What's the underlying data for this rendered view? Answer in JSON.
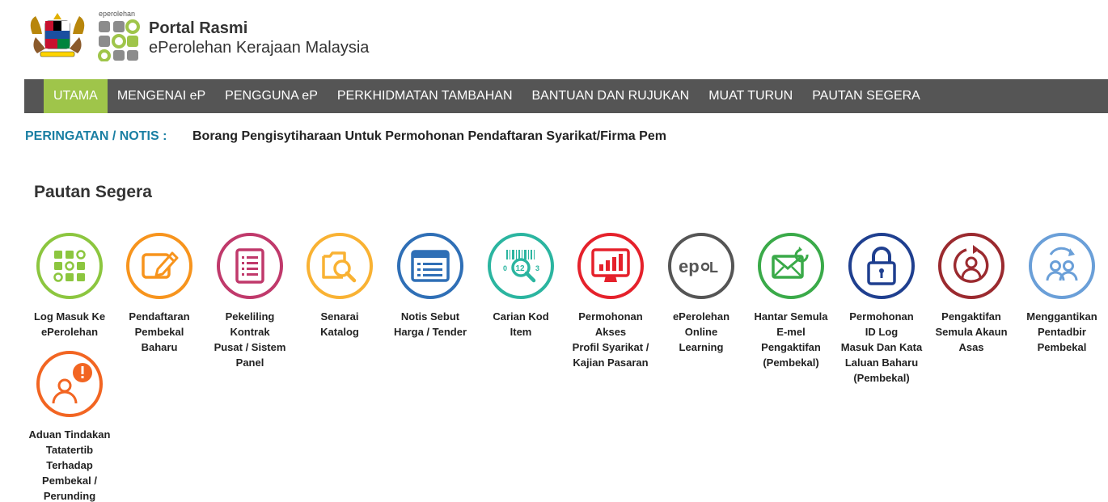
{
  "header": {
    "logo_small_text": "eperolehan",
    "title": "Portal Rasmi",
    "subtitle": "ePerolehan Kerajaan Malaysia"
  },
  "nav": {
    "items": [
      {
        "label": "UTAMA"
      },
      {
        "label": "MENGENAI eP"
      },
      {
        "label": "PENGGUNA eP"
      },
      {
        "label": "PERKHIDMATAN TAMBAHAN"
      },
      {
        "label": "BANTUAN DAN RUJUKAN"
      },
      {
        "label": "MUAT TURUN"
      },
      {
        "label": "PAUTAN SEGERA"
      }
    ],
    "active_index": 0,
    "active_color": "#9fc54a",
    "bar_color": "#555555"
  },
  "notice": {
    "label": "PERINGATAN / NOTIS :",
    "text": "Borang Pengisytiharaan Untuk Permohonan Pendaftaran Syarikat/Firma Pembekal",
    "label_color": "#1a7fa3"
  },
  "quick_links": {
    "title": "Pautan Segera",
    "items": [
      {
        "label": "Log Masuk Ke\nePerolehan",
        "icon": "grid-login-icon",
        "color": "#8cc63f"
      },
      {
        "label": "Pendaftaran\nPembekal\nBaharu",
        "icon": "form-pencil-icon",
        "color": "#f7941d"
      },
      {
        "label": "Pekeliling Kontrak\nPusat / Sistem\nPanel",
        "icon": "document-list-icon",
        "color": "#c0396b"
      },
      {
        "label": "Senarai\nKatalog",
        "icon": "folder-search-icon",
        "color": "#f9b233"
      },
      {
        "label": "Notis Sebut\nHarga / Tender",
        "icon": "browser-window-icon",
        "color": "#2f6fb6"
      },
      {
        "label": "Carian Kod\nItem",
        "icon": "barcode-search-icon",
        "color": "#2bb5a0"
      },
      {
        "label": "Permohonan\nAkses\nProfil Syarikat /\nKajian Pasaran",
        "icon": "monitor-chart-icon",
        "color": "#e5212b"
      },
      {
        "label": "ePerolehan\nOnline\nLearning",
        "icon": "epol-icon",
        "color": "#555555"
      },
      {
        "label": "Hantar Semula\nE-mel\nPengaktifan\n(Pembekal)",
        "icon": "envelope-resend-icon",
        "color": "#3aaa49"
      },
      {
        "label": "Permohonan\nID Log\nMasuk Dan Kata\nLaluan Baharu\n(Pembekal)",
        "icon": "padlock-icon",
        "color": "#1f3f8f"
      },
      {
        "label": "Pengaktifan\nSemula Akaun\nAsas",
        "icon": "user-reactivate-icon",
        "color": "#9b2a2f"
      },
      {
        "label": "Menggantikan\nPentadbir\nPembekal",
        "icon": "users-swap-icon",
        "color": "#6a9fd8"
      },
      {
        "label": "Aduan Tindakan\nTatatertib Terhadap\nPembekal / Perunding",
        "icon": "user-alert-icon",
        "color": "#f26522"
      }
    ]
  }
}
